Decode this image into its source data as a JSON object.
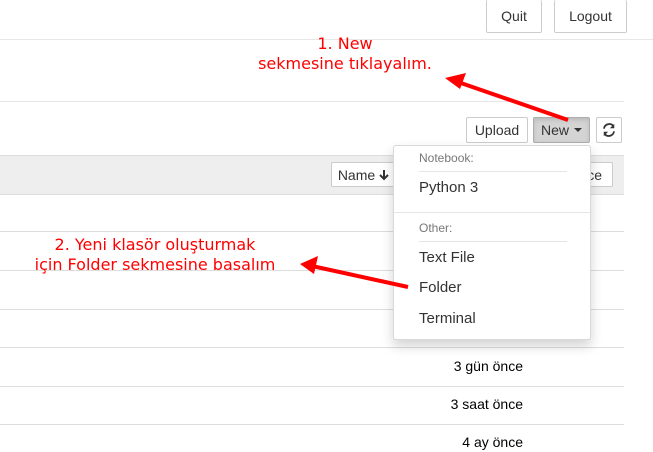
{
  "header": {
    "quit_label": "Quit",
    "logout_label": "Logout"
  },
  "toolbar": {
    "upload_label": "Upload",
    "new_label": "New",
    "refresh_icon": "refresh-icon"
  },
  "list_header": {
    "name_label": "Name",
    "sort_icon": "arrow-down-icon",
    "last_modified_partial": "ce"
  },
  "rows": [
    {
      "modified": ""
    },
    {
      "modified": ""
    },
    {
      "modified": ""
    },
    {
      "modified": ""
    },
    {
      "modified": "3 gün önce"
    },
    {
      "modified": "3 saat önce"
    },
    {
      "modified": "4 ay önce"
    }
  ],
  "dropdown": {
    "notebook_header": "Notebook:",
    "notebook_items": [
      "Python 3"
    ],
    "other_header": "Other:",
    "other_items": [
      "Text File",
      "Folder",
      "Terminal"
    ]
  },
  "annotations": {
    "step1_line1": "1. New",
    "step1_line2": "sekmesine tıklayalım.",
    "step2_line1": "2. Yeni klasör oluşturmak",
    "step2_line2": "için Folder sekmesine basalım"
  },
  "colors": {
    "annotation": "#ff0000",
    "panel_header": "#eeeeee"
  }
}
